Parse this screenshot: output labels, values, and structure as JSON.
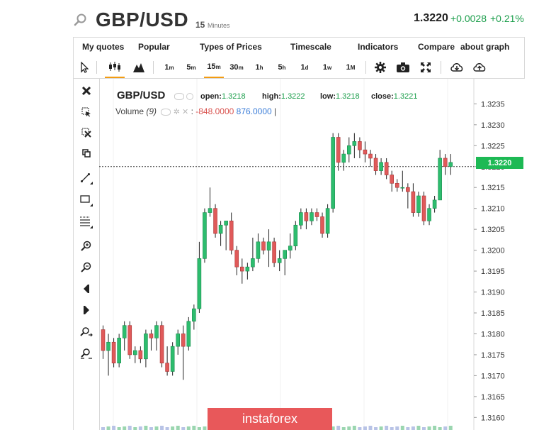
{
  "header": {
    "symbol": "GBP/USD",
    "interval_num": "15",
    "interval_unit": "Minutes",
    "price": "1.3220",
    "change": "+0.0028",
    "change_pct": "+0.21%"
  },
  "menu": {
    "items": [
      "My quotes",
      "Popular",
      "Types of Prices",
      "Timescale",
      "Indicators",
      "Compare",
      "about graph"
    ]
  },
  "toolbar": {
    "timeframes": [
      {
        "n": "1",
        "u": "m"
      },
      {
        "n": "5",
        "u": "m"
      },
      {
        "n": "15",
        "u": "m"
      },
      {
        "n": "30",
        "u": "m"
      },
      {
        "n": "1",
        "u": "h"
      },
      {
        "n": "5",
        "u": "h"
      },
      {
        "n": "1",
        "u": "d"
      },
      {
        "n": "1",
        "u": "w"
      },
      {
        "n": "1",
        "u": "M"
      }
    ],
    "active_timeframe": "15m"
  },
  "legend": {
    "symbol": "GBP/USD",
    "open_label": "open:",
    "open": "1.3218",
    "high_label": "high:",
    "high": "1.3222",
    "low_label": "low:",
    "low": "1.3218",
    "close_label": "close:",
    "close": "1.3221",
    "volume_label": "Volume",
    "volume_period": "(9)",
    "volume_neg": "-848.0000",
    "volume_pos": "876.0000"
  },
  "watermark": "instaforex",
  "current_price_tag": "1.3220",
  "colors": {
    "up": "#1b9e4b",
    "down": "#d9534f",
    "accent": "#f39c12",
    "watermark": "#e8585a"
  },
  "chart_data": {
    "type": "candlestick",
    "ylim": [
      1.3157,
      1.3241
    ],
    "yticks": [
      "1.3160",
      "1.3165",
      "1.3170",
      "1.3175",
      "1.3180",
      "1.3185",
      "1.3190",
      "1.3195",
      "1.3200",
      "1.3205",
      "1.3210",
      "1.3215",
      "1.3220",
      "1.3225",
      "1.3230",
      "1.3235"
    ],
    "last_price": 1.322,
    "candles": [
      [
        1.3181,
        1.3182,
        1.3174,
        1.3176
      ],
      [
        1.3176,
        1.318,
        1.317,
        1.3178
      ],
      [
        1.3178,
        1.3179,
        1.3172,
        1.3173
      ],
      [
        1.3173,
        1.318,
        1.3172,
        1.3179
      ],
      [
        1.3179,
        1.3183,
        1.3176,
        1.3182
      ],
      [
        1.3182,
        1.3183,
        1.3174,
        1.3175
      ],
      [
        1.3175,
        1.3177,
        1.3173,
        1.3176
      ],
      [
        1.3176,
        1.3177,
        1.3173,
        1.3174
      ],
      [
        1.3174,
        1.3181,
        1.3172,
        1.318
      ],
      [
        1.318,
        1.3181,
        1.3176,
        1.3179
      ],
      [
        1.3179,
        1.3183,
        1.3176,
        1.3182
      ],
      [
        1.3182,
        1.3183,
        1.3172,
        1.3173
      ],
      [
        1.3173,
        1.3177,
        1.317,
        1.3171
      ],
      [
        1.3171,
        1.3178,
        1.317,
        1.3177
      ],
      [
        1.3177,
        1.3181,
        1.3175,
        1.318
      ],
      [
        1.318,
        1.3182,
        1.3169,
        1.3177
      ],
      [
        1.3177,
        1.3184,
        1.3176,
        1.3183
      ],
      [
        1.3183,
        1.3187,
        1.3181,
        1.3186
      ],
      [
        1.3186,
        1.3202,
        1.3185,
        1.3198
      ],
      [
        1.3198,
        1.321,
        1.3197,
        1.3209
      ],
      [
        1.3209,
        1.3215,
        1.3208,
        1.321
      ],
      [
        1.321,
        1.3211,
        1.3203,
        1.3204
      ],
      [
        1.3204,
        1.3207,
        1.3201,
        1.3206
      ],
      [
        1.3206,
        1.3207,
        1.32,
        1.3207
      ],
      [
        1.3207,
        1.3209,
        1.3199,
        1.32
      ],
      [
        1.32,
        1.3201,
        1.3194,
        1.3196
      ],
      [
        1.3196,
        1.3198,
        1.3192,
        1.3195
      ],
      [
        1.3195,
        1.3197,
        1.3193,
        1.3196
      ],
      [
        1.3196,
        1.3203,
        1.3195,
        1.3198
      ],
      [
        1.3198,
        1.3204,
        1.3197,
        1.3202
      ],
      [
        1.3202,
        1.3203,
        1.3199,
        1.32
      ],
      [
        1.32,
        1.3205,
        1.3196,
        1.3202
      ],
      [
        1.3202,
        1.3203,
        1.3196,
        1.3197
      ],
      [
        1.3197,
        1.32,
        1.3195,
        1.3198
      ],
      [
        1.3198,
        1.3199,
        1.3194,
        1.32
      ],
      [
        1.32,
        1.3204,
        1.3198,
        1.3201
      ],
      [
        1.3201,
        1.3207,
        1.32,
        1.3206
      ],
      [
        1.3206,
        1.321,
        1.3205,
        1.3209
      ],
      [
        1.3209,
        1.321,
        1.3205,
        1.3207
      ],
      [
        1.3207,
        1.321,
        1.3206,
        1.3209
      ],
      [
        1.3209,
        1.321,
        1.3207,
        1.3208
      ],
      [
        1.3208,
        1.3209,
        1.3203,
        1.3204
      ],
      [
        1.3204,
        1.3211,
        1.3203,
        1.321
      ],
      [
        1.321,
        1.3228,
        1.3209,
        1.3227
      ],
      [
        1.3227,
        1.3228,
        1.3219,
        1.3221
      ],
      [
        1.3221,
        1.3224,
        1.3219,
        1.3223
      ],
      [
        1.3223,
        1.3227,
        1.3221,
        1.3225
      ],
      [
        1.3225,
        1.3228,
        1.3222,
        1.3226
      ],
      [
        1.3226,
        1.3227,
        1.3222,
        1.3224
      ],
      [
        1.3224,
        1.3226,
        1.3221,
        1.3223
      ],
      [
        1.3223,
        1.3224,
        1.322,
        1.3222
      ],
      [
        1.3222,
        1.3223,
        1.3218,
        1.3219
      ],
      [
        1.3219,
        1.3222,
        1.3218,
        1.3221
      ],
      [
        1.3221,
        1.3222,
        1.3217,
        1.3218
      ],
      [
        1.3218,
        1.3219,
        1.3214,
        1.3216
      ],
      [
        1.3216,
        1.3217,
        1.3214,
        1.3215
      ],
      [
        1.3215,
        1.3219,
        1.3214,
        1.3215
      ],
      [
        1.3215,
        1.3216,
        1.321,
        1.3214
      ],
      [
        1.3214,
        1.3216,
        1.3208,
        1.3209
      ],
      [
        1.3209,
        1.3214,
        1.3208,
        1.3213
      ],
      [
        1.3213,
        1.3214,
        1.3206,
        1.3207
      ],
      [
        1.3207,
        1.3211,
        1.3206,
        1.321
      ],
      [
        1.321,
        1.3213,
        1.3209,
        1.3212
      ],
      [
        1.3212,
        1.3224,
        1.3212,
        1.3222
      ],
      [
        1.3222,
        1.3223,
        1.3218,
        1.322
      ],
      [
        1.322,
        1.3223,
        1.3218,
        1.3221
      ]
    ]
  }
}
